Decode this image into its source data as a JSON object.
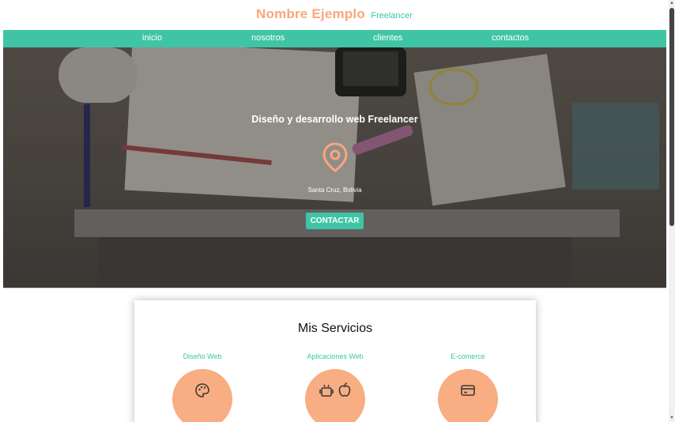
{
  "header": {
    "brand_name": "Nombre Ejemplo",
    "brand_sub": "Freelancer"
  },
  "nav": {
    "items": [
      "inicio",
      "nosotros",
      "clientes",
      "contactos"
    ]
  },
  "hero": {
    "title": "Diseño y desarrollo web Freelancer",
    "location": "Santa Cruz, Bolivia",
    "cta_label": "CONTACTAR"
  },
  "services": {
    "title": "Mis Servicios",
    "items": [
      {
        "label": "Diseño Web",
        "icon": "palette-icon"
      },
      {
        "label": "Aplicaciones Web",
        "icon": "android-apple-icon"
      },
      {
        "label": "E-comerce",
        "icon": "credit-card-icon"
      }
    ]
  },
  "colors": {
    "accent": "#3fc5a5",
    "brand": "#f8a77c"
  }
}
